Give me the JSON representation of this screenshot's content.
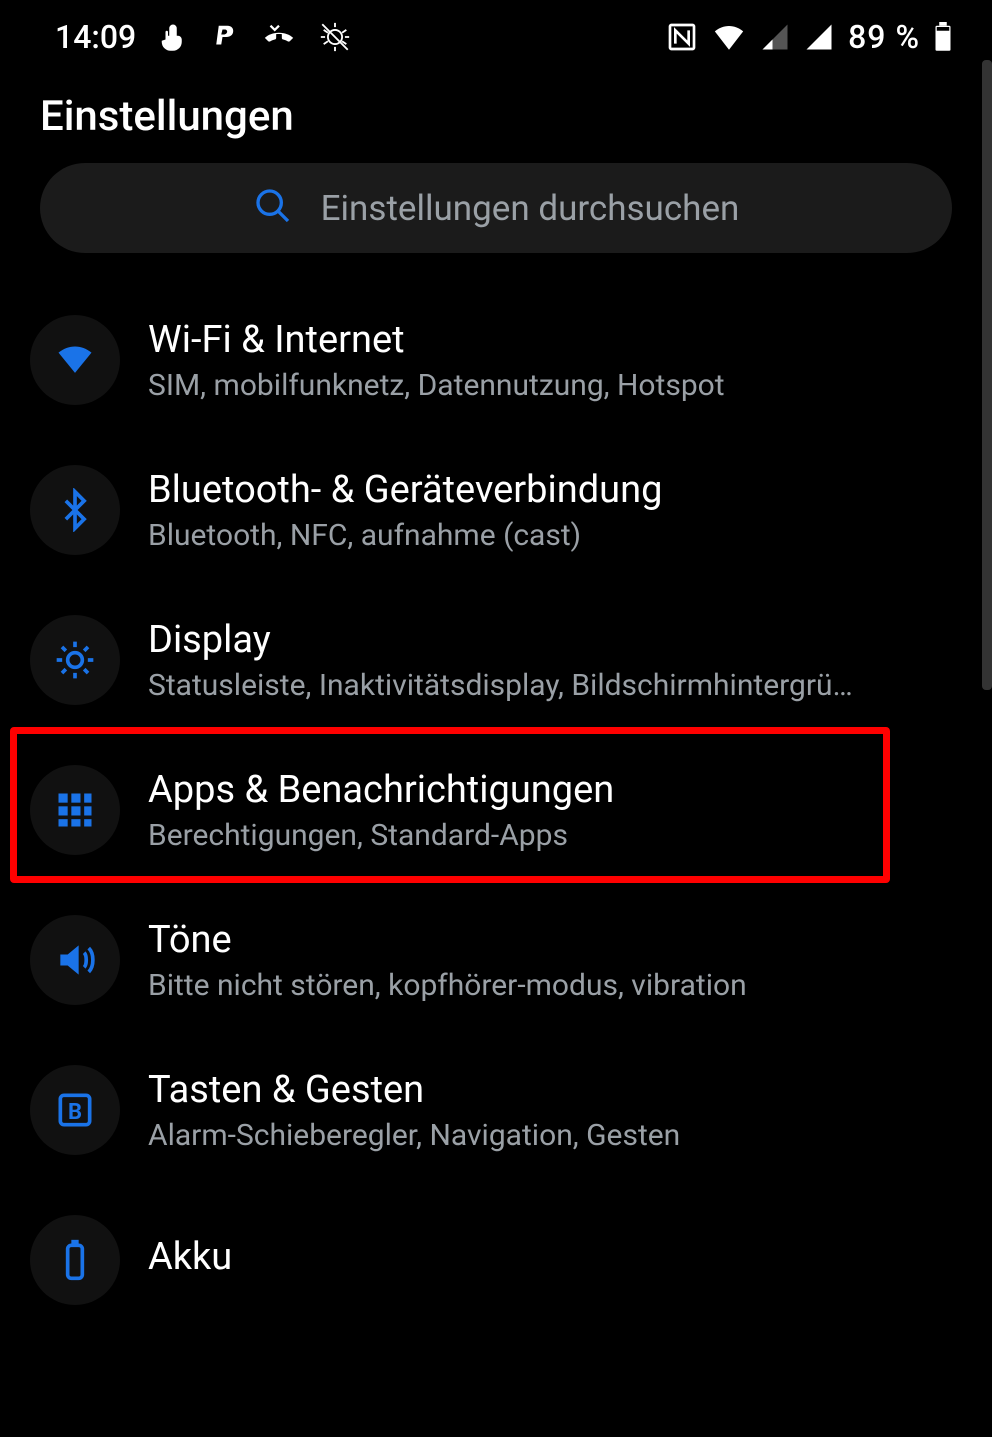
{
  "status": {
    "time": "14:09",
    "battery_pct": "89 %"
  },
  "page_title": "Einstellungen",
  "search": {
    "placeholder": "Einstellungen durchsuchen"
  },
  "items": [
    {
      "title": "Wi-Fi & Internet",
      "sub": "SIM, mobilfunknetz, Datennutzung, Hotspot"
    },
    {
      "title": "Bluetooth- & Geräteverbindung",
      "sub": "Bluetooth, NFC, aufnahme (cast)"
    },
    {
      "title": "Display",
      "sub": "Statusleiste, Inaktivitätsdisplay, Bildschirmhintergrü…"
    },
    {
      "title": "Apps & Benachrichtigungen",
      "sub": "Berechtigungen, Standard-Apps"
    },
    {
      "title": "Töne",
      "sub": "Bitte nicht stören, kopfhörer-modus, vibration"
    },
    {
      "title": "Tasten & Gesten",
      "sub": "Alarm-Schieberegler, Navigation, Gesten"
    },
    {
      "title": "Akku",
      "sub": ""
    }
  ],
  "highlight_index": 3,
  "accent": "#1a73e8"
}
